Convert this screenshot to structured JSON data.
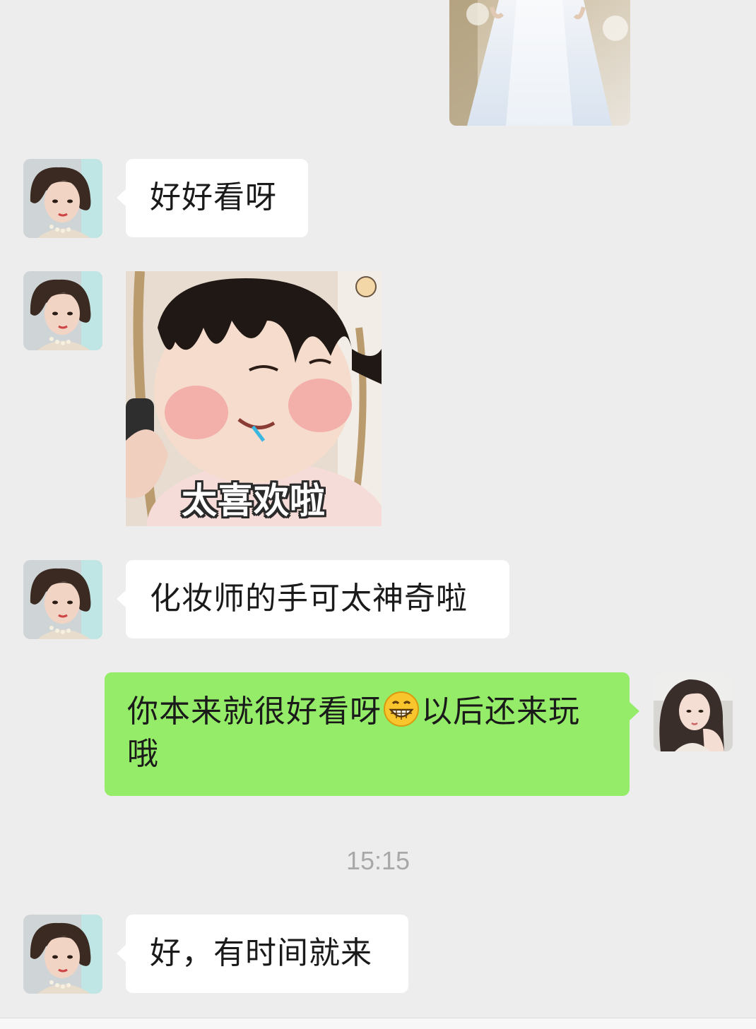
{
  "messages": {
    "m1": {
      "sender": "contact",
      "type": "text",
      "text": "好好看呀"
    },
    "m2": {
      "sender": "contact",
      "type": "sticker",
      "caption": "太喜欢啦"
    },
    "m3": {
      "sender": "contact",
      "type": "text",
      "text": "化妆师的手可太神奇啦"
    },
    "m4": {
      "sender": "me",
      "type": "text",
      "text_before": "你本来就很好看呀",
      "emoji": "grinning-face-emoji",
      "text_after": "以后还来玩哦"
    },
    "m5": {
      "sender": "contact",
      "type": "text",
      "text": "好，有时间就来"
    }
  },
  "timestamp": "15:15",
  "colors": {
    "background": "#ededed",
    "incoming_bubble": "#ffffff",
    "outgoing_bubble": "#95ec69",
    "timestamp_text": "#a8a8a8"
  },
  "icons": {
    "contact_avatar": "contact-avatar-photo",
    "my_avatar": "my-avatar-photo",
    "photo": "wedding-dress-photo"
  }
}
